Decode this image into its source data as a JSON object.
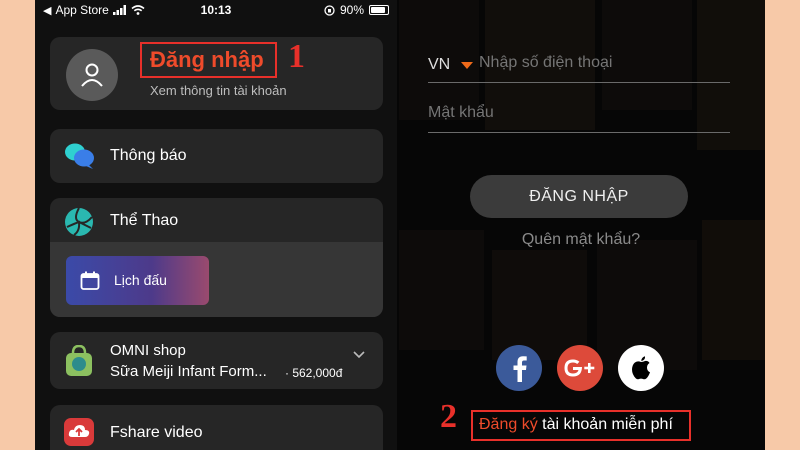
{
  "status_bar": {
    "carrier": "App Store",
    "time": "10:13",
    "battery_percent": 90,
    "battery_label": "90%"
  },
  "left_screen": {
    "profile": {
      "login_label": "Đăng nhập",
      "subtitle": "Xem thông tin tài khoản",
      "annotation_number": "1"
    },
    "menu": {
      "notifications": "Thông báo",
      "sports": "Thể Thao",
      "schedule": "Lịch đấu",
      "omni_title": "OMNI shop",
      "omni_product": "Sữa Meiji Infant Form...",
      "omni_price": "· 562,000đ",
      "fshare": "Fshare video"
    }
  },
  "right_screen": {
    "country_code": "VN",
    "phone_placeholder": "Nhập số điện thoại",
    "password_placeholder": "Mật khẩu",
    "login_button": "ĐĂNG NHẬP",
    "forgot_password": "Quên mật khẩu?",
    "social_icons": [
      "facebook-icon",
      "google-plus-icon",
      "apple-icon"
    ],
    "annotation_number": "2",
    "register_link": "Đăng ký",
    "register_rest": " tài khoản miễn phí"
  },
  "colors": {
    "background": "#f7c9a8",
    "annotation_red": "#e8302a",
    "brand_orange": "#ef4b2b",
    "facebook": "#3b5a9a",
    "google_plus": "#dd4a3a"
  }
}
